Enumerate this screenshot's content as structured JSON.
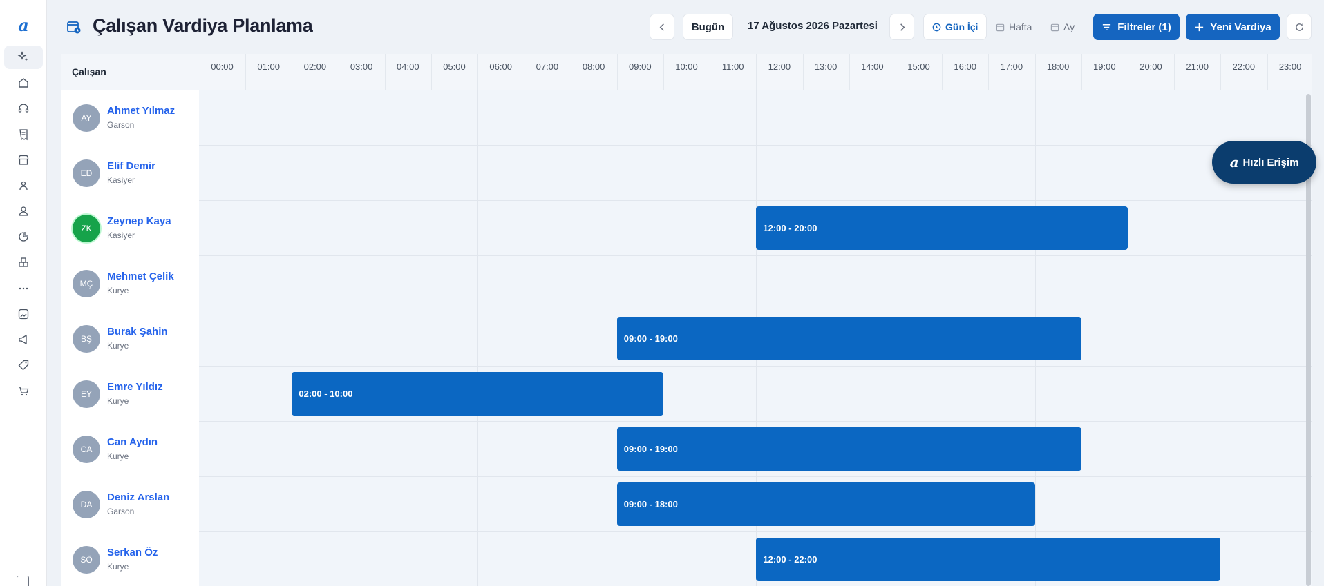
{
  "app": {
    "logo": "a",
    "title": "Çalışan Vardiya Planlama"
  },
  "toolbar": {
    "today_label": "Bugün",
    "date_label": "17 Ağustos 2026 Pazartesi",
    "views": [
      "Gün İçi",
      "Hafta",
      "Ay"
    ],
    "filters_label": "Filtreler (1)",
    "new_shift_label": "Yeni Vardiya"
  },
  "grid": {
    "employee_column": "Çalışan",
    "hours": [
      "00:00",
      "01:00",
      "02:00",
      "03:00",
      "04:00",
      "05:00",
      "06:00",
      "07:00",
      "08:00",
      "09:00",
      "10:00",
      "11:00",
      "12:00",
      "13:00",
      "14:00",
      "15:00",
      "16:00",
      "17:00",
      "18:00",
      "19:00",
      "20:00",
      "21:00",
      "22:00",
      "23:00"
    ]
  },
  "employees": [
    {
      "initials": "AY",
      "name": "Ahmet Yılmaz",
      "role": "Garson",
      "shift": null
    },
    {
      "initials": "ED",
      "name": "Elif Demir",
      "role": "Kasiyer",
      "shift": null
    },
    {
      "initials": "ZK",
      "name": "Zeynep Kaya",
      "role": "Kasiyer",
      "highlight": true,
      "shift": {
        "label": "12:00 - 20:00",
        "start": 12,
        "end": 20
      }
    },
    {
      "initials": "MÇ",
      "name": "Mehmet Çelik",
      "role": "Kurye",
      "shift": null
    },
    {
      "initials": "BŞ",
      "name": "Burak Şahin",
      "role": "Kurye",
      "shift": {
        "label": "09:00 - 19:00",
        "start": 9,
        "end": 19
      }
    },
    {
      "initials": "EY",
      "name": "Emre Yıldız",
      "role": "Kurye",
      "shift": {
        "label": "02:00 - 10:00",
        "start": 2,
        "end": 10
      }
    },
    {
      "initials": "CA",
      "name": "Can Aydın",
      "role": "Kurye",
      "shift": {
        "label": "09:00 - 19:00",
        "start": 9,
        "end": 19
      }
    },
    {
      "initials": "DA",
      "name": "Deniz Arslan",
      "role": "Garson",
      "shift": {
        "label": "09:00 - 18:00",
        "start": 9,
        "end": 18
      }
    },
    {
      "initials": "SÖ",
      "name": "Serkan Öz",
      "role": "Kurye",
      "shift": {
        "label": "12:00 - 22:00",
        "start": 12,
        "end": 22
      }
    }
  ],
  "quick_access": {
    "logo": "a",
    "label": "Hızlı Erişim"
  },
  "colors": {
    "accent": "#1565c0",
    "shift": "#0b67c2",
    "name": "#2563eb",
    "avatar": "#94a3b8",
    "avatar_active": "#16a34a"
  },
  "sidebar_icons": [
    "sparkle-icon",
    "home-icon",
    "headset-icon",
    "receipt-icon",
    "store-icon",
    "users-icon",
    "user-icon",
    "chart-icon",
    "boxes-icon",
    "more-icon",
    "gallery-icon",
    "megaphone-icon",
    "tag-icon",
    "cart-icon"
  ]
}
